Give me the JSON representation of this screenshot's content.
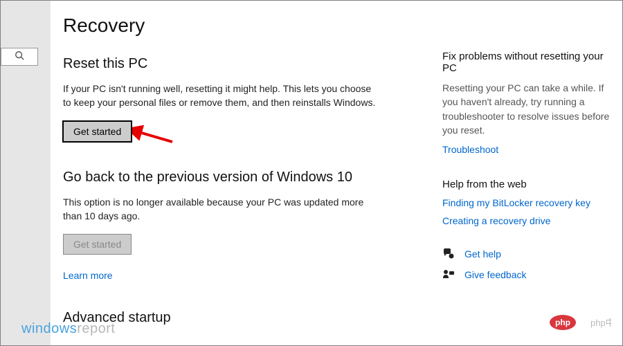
{
  "page": {
    "title": "Recovery"
  },
  "reset": {
    "heading": "Reset this PC",
    "description": "If your PC isn't running well, resetting it might help. This lets you choose to keep your personal files or remove them, and then reinstalls Windows.",
    "button": "Get started"
  },
  "goback": {
    "heading": "Go back to the previous version of Windows 10",
    "description": "This option is no longer available because your PC was updated more than 10 days ago.",
    "button": "Get started",
    "learn_more": "Learn more"
  },
  "advanced": {
    "heading": "Advanced startup"
  },
  "sidebar": {
    "fix": {
      "heading": "Fix problems without resetting your PC",
      "description": "Resetting your PC can take a while. If you haven't already, try running a troubleshooter to resolve issues before you reset.",
      "link": "Troubleshoot"
    },
    "web": {
      "heading": "Help from the web",
      "links": [
        "Finding my BitLocker recovery key",
        "Creating a recovery drive"
      ]
    },
    "footer": {
      "help": "Get help",
      "feedback": "Give feedback"
    }
  },
  "watermarks": {
    "wr_prefix": "windows",
    "wr_suffix": "report",
    "php": "php中文网"
  }
}
